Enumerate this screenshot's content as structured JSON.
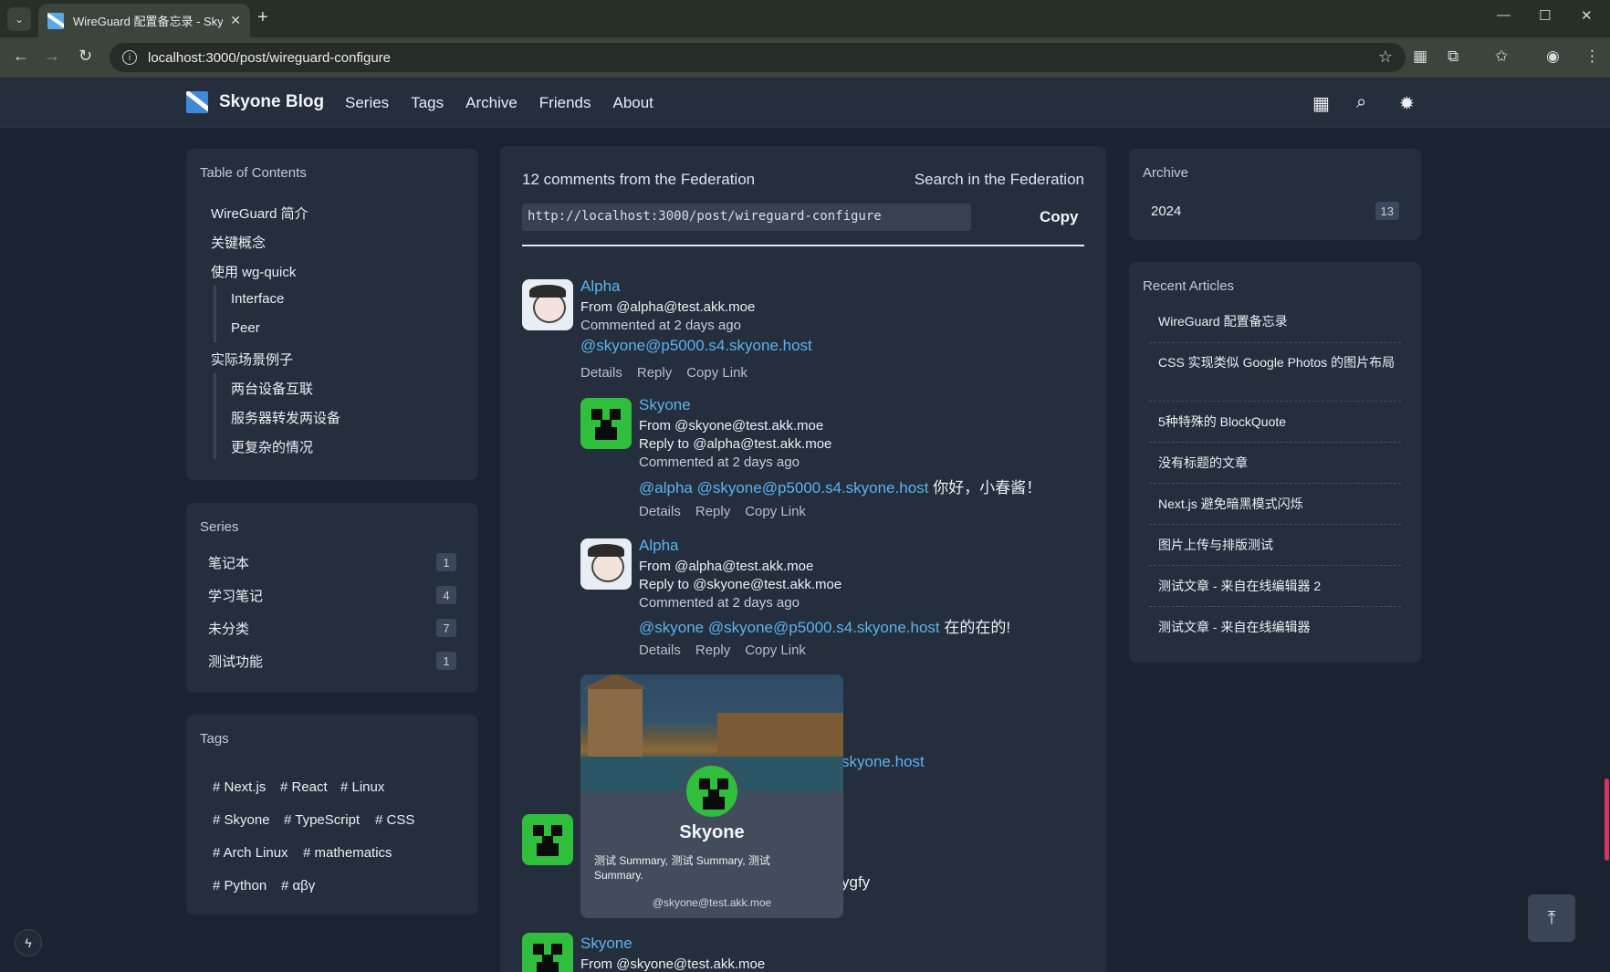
{
  "browser": {
    "tab_title": "WireGuard 配置备忘录 - Skyone Blog",
    "url": "localhost:3000/post/wireguard-configure"
  },
  "header": {
    "brand": "Skyone Blog",
    "nav": [
      "Series",
      "Tags",
      "Archive",
      "Friends",
      "About"
    ]
  },
  "toc": {
    "title": "Table of Contents",
    "items": [
      "WireGuard 简介",
      "关键概念",
      "使用 wg-quick",
      "Interface",
      "Peer",
      "实际场景例子",
      "两台设备互联",
      "服务器转发两设备",
      "更复杂的情况"
    ]
  },
  "series": {
    "title": "Series",
    "items": [
      {
        "name": "笔记本",
        "count": "1"
      },
      {
        "name": "学习笔记",
        "count": "4"
      },
      {
        "name": "未分类",
        "count": "7"
      },
      {
        "name": "测试功能",
        "count": "1"
      }
    ]
  },
  "tags": {
    "title": "Tags",
    "items": [
      "# Next.js",
      "# React",
      "# Linux",
      "# Skyone",
      "# TypeScript",
      "# CSS",
      "# Arch Linux",
      "# mathematics",
      "# Python",
      "# αβγ"
    ]
  },
  "federation": {
    "heading": "12 comments from the Federation",
    "search": "Search in the Federation",
    "url": "http://localhost:3000/post/wireguard-configure",
    "copy": "Copy"
  },
  "comments": [
    {
      "name": "Alpha",
      "from": "From @alpha@test.akk.moe",
      "time": "Commented at 2 days ago",
      "mention1": "@skyone@p5000.s4.skyone.host",
      "actions": [
        "Details",
        "Reply",
        "Copy Link"
      ]
    },
    {
      "name": "Skyone",
      "from": "From @skyone@test.akk.moe",
      "reply_to": "Reply to @alpha@test.akk.moe",
      "time": "Commented at 2 days ago",
      "mention1": "@alpha",
      "mention2": "@skyone@p5000.s4.skyone.host",
      "text": "你好，小春酱！",
      "actions": [
        "Details",
        "Reply",
        "Copy Link"
      ]
    },
    {
      "name": "Alpha",
      "from": "From @alpha@test.akk.moe",
      "reply_to": "Reply to @skyone@test.akk.moe",
      "time": "Commented at 2 days ago",
      "mention1": "@skyone",
      "mention2": "@skyone@p5000.s4.skyone.host",
      "text": "在的在的!",
      "actions": [
        "Details",
        "Reply",
        "Copy Link"
      ]
    }
  ],
  "partial": {
    "mention_tail": "skyone.host",
    "text_tail": "ygfy",
    "bottom_name": "Skyone",
    "bottom_from": "From @skyone@test.akk.moe"
  },
  "popover": {
    "name": "Skyone",
    "summary": "测试 Summary, 测试 Summary, 测试 Summary.",
    "handle": "@skyone@test.akk.moe"
  },
  "archive": {
    "title": "Archive",
    "year": "2024",
    "count": "13"
  },
  "recent": {
    "title": "Recent Articles",
    "items": [
      "WireGuard 配置备忘录",
      "CSS 实现类似 Google Photos 的图片布局",
      "5种特殊的 BlockQuote",
      "没有标题的文章",
      "Next.js 避免暗黑模式闪烁",
      "图片上传与排版测试",
      "测试文章 - 来自在线编辑器 2",
      "测试文章 - 来自在线编辑器"
    ]
  },
  "colors": {
    "accent_link": "#5bb3f0",
    "page_bg": "#1b2230",
    "card_bg": "#252e3c",
    "scroll_thumb": "#d6335f"
  }
}
